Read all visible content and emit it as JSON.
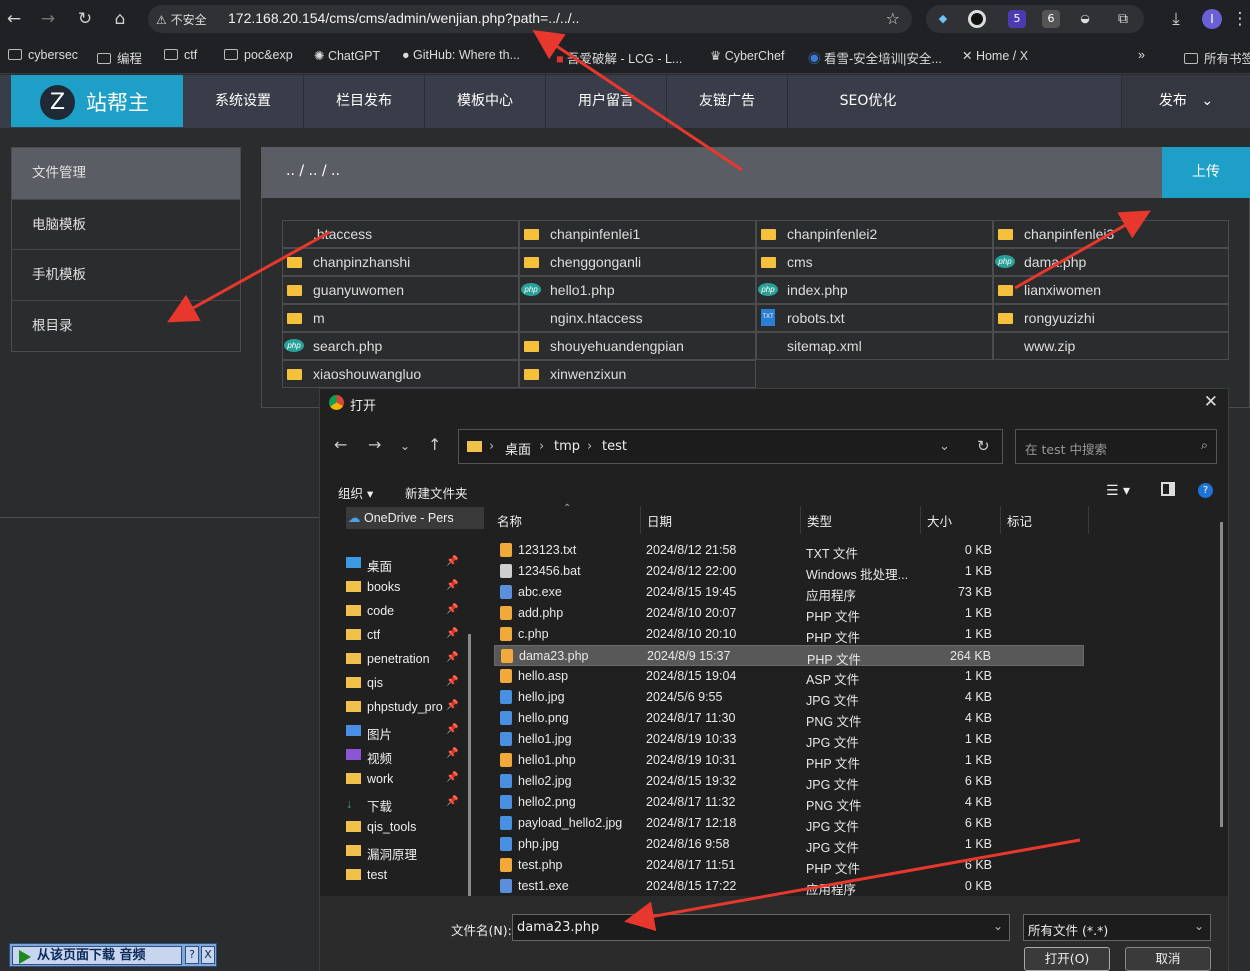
{
  "browser": {
    "security_label": "不安全",
    "url": "172.168.20.154/cms/cms/admin/wenjian.php?path=../../..",
    "extension_badges": [
      "5",
      "6"
    ],
    "profile_initial": "I"
  },
  "bookmarks": [
    "cybersec",
    "编程",
    "ctf",
    "poc&exp",
    "ChatGPT",
    "GitHub: Where th...",
    "吾爱破解 - LCG - L...",
    "CyberChef",
    "看雪-安全培训|安全...",
    "Home / X",
    "所有书签"
  ],
  "cms": {
    "logo_letter": "Z",
    "logo_text": "站帮主",
    "nav": [
      "系统设置",
      "栏目发布",
      "模板中心",
      "用户留言",
      "友链广告",
      "SEO优化"
    ],
    "publish": "发布",
    "sidebar": [
      "文件管理",
      "电脑模板",
      "手机模板",
      "根目录"
    ],
    "path": ".. / .. / ..",
    "upload": "上传",
    "files": [
      {
        "name": ".htaccess",
        "type": "none"
      },
      {
        "name": "chanpinfenlei1",
        "type": "folder"
      },
      {
        "name": "chanpinfenlei2",
        "type": "folder"
      },
      {
        "name": "chanpinfenlei3",
        "type": "folder"
      },
      {
        "name": "chanpinzhanshi",
        "type": "folder"
      },
      {
        "name": "chenggonganli",
        "type": "folder"
      },
      {
        "name": "cms",
        "type": "folder"
      },
      {
        "name": "dama.php",
        "type": "php"
      },
      {
        "name": "guanyuwomen",
        "type": "folder"
      },
      {
        "name": "hello1.php",
        "type": "php"
      },
      {
        "name": "index.php",
        "type": "php"
      },
      {
        "name": "lianxiwomen",
        "type": "folder"
      },
      {
        "name": "m",
        "type": "folder"
      },
      {
        "name": "nginx.htaccess",
        "type": "none"
      },
      {
        "name": "robots.txt",
        "type": "txt"
      },
      {
        "name": "rongyuzizhi",
        "type": "folder"
      },
      {
        "name": "search.php",
        "type": "php"
      },
      {
        "name": "shouyehuandengpian",
        "type": "folder"
      },
      {
        "name": "sitemap.xml",
        "type": "none"
      },
      {
        "name": "www.zip",
        "type": "none"
      },
      {
        "name": "xiaoshouwangluo",
        "type": "folder"
      },
      {
        "name": "xinwenzixun",
        "type": "folder"
      }
    ]
  },
  "dialog": {
    "title": "打开",
    "breadcrumb": [
      "桌面",
      "tmp",
      "test"
    ],
    "search_placeholder": "在 test 中搜索",
    "toolbar": {
      "organize": "组织",
      "new_folder": "新建文件夹"
    },
    "nav_pane": [
      "OneDrive - Pers",
      "桌面",
      "books",
      "code",
      "ctf",
      "penetration",
      "qis",
      "phpstudy_pro",
      "图片",
      "视频",
      "work",
      "下载",
      "qis_tools",
      "漏洞原理",
      "test"
    ],
    "columns": [
      "名称",
      "日期",
      "类型",
      "大小",
      "标记"
    ],
    "files": [
      {
        "name": "123123.txt",
        "date": "2024/8/12 21:58",
        "type": "TXT 文件",
        "size": "0 KB",
        "icon": "sublime"
      },
      {
        "name": "123456.bat",
        "date": "2024/8/12 22:00",
        "type": "Windows 批处理...",
        "size": "1 KB",
        "icon": "bat"
      },
      {
        "name": "abc.exe",
        "date": "2024/8/15 19:45",
        "type": "应用程序",
        "size": "73 KB",
        "icon": "exe"
      },
      {
        "name": "add.php",
        "date": "2024/8/10 20:07",
        "type": "PHP 文件",
        "size": "1 KB",
        "icon": "sublime"
      },
      {
        "name": "c.php",
        "date": "2024/8/10 20:10",
        "type": "PHP 文件",
        "size": "1 KB",
        "icon": "sublime"
      },
      {
        "name": "dama23.php",
        "date": "2024/8/9 15:37",
        "type": "PHP 文件",
        "size": "264 KB",
        "icon": "sublime"
      },
      {
        "name": "hello.asp",
        "date": "2024/8/15 19:04",
        "type": "ASP 文件",
        "size": "1 KB",
        "icon": "sublime"
      },
      {
        "name": "hello.jpg",
        "date": "2024/5/6 9:55",
        "type": "JPG 文件",
        "size": "4 KB",
        "icon": "img"
      },
      {
        "name": "hello.png",
        "date": "2024/8/17 11:30",
        "type": "PNG 文件",
        "size": "4 KB",
        "icon": "img"
      },
      {
        "name": "hello1.jpg",
        "date": "2024/8/19 10:33",
        "type": "JPG 文件",
        "size": "1 KB",
        "icon": "img"
      },
      {
        "name": "hello1.php",
        "date": "2024/8/19 10:31",
        "type": "PHP 文件",
        "size": "1 KB",
        "icon": "sublime"
      },
      {
        "name": "hello2.jpg",
        "date": "2024/8/15 19:32",
        "type": "JPG 文件",
        "size": "6 KB",
        "icon": "img"
      },
      {
        "name": "hello2.png",
        "date": "2024/8/17 11:32",
        "type": "PNG 文件",
        "size": "4 KB",
        "icon": "img"
      },
      {
        "name": "payload_hello2.jpg",
        "date": "2024/8/17 12:18",
        "type": "JPG 文件",
        "size": "6 KB",
        "icon": "img"
      },
      {
        "name": "php.jpg",
        "date": "2024/8/16 9:58",
        "type": "JPG 文件",
        "size": "1 KB",
        "icon": "img"
      },
      {
        "name": "test.php",
        "date": "2024/8/17 11:51",
        "type": "PHP 文件",
        "size": "6 KB",
        "icon": "sublime"
      },
      {
        "name": "test1.exe",
        "date": "2024/8/15 17:22",
        "type": "应用程序",
        "size": "0 KB",
        "icon": "exe"
      }
    ],
    "selected": "dama23.php",
    "filename_label": "文件名(N):",
    "filename_value": "dama23.php",
    "filetype": "所有文件 (*.*)",
    "open_button": "打开(O)",
    "cancel_button": "取消"
  },
  "music_bar": {
    "label": "从该页面下载 音频",
    "help": "?",
    "close": "X"
  },
  "colors": {
    "accent": "#1e9fc7",
    "nav_bg": "#393d49",
    "arrow": "#e8382d"
  }
}
